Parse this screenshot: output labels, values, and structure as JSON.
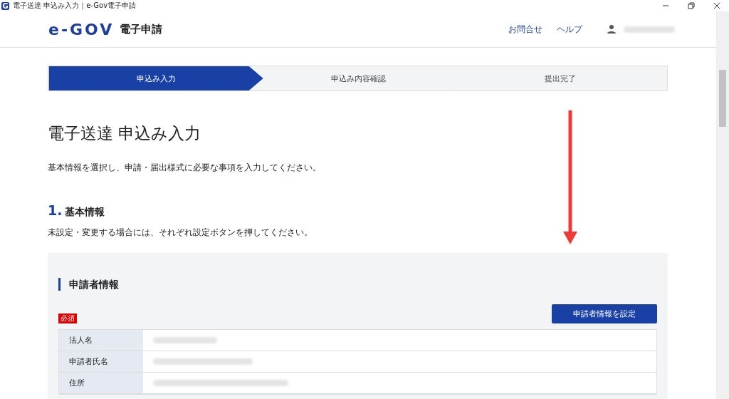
{
  "window": {
    "icon": "G",
    "title": "電子送達 申込み入力｜e-Gov電子申請"
  },
  "header": {
    "logo": "e-GOV",
    "service": "電子申請",
    "links": [
      "お問合せ",
      "ヘルプ"
    ]
  },
  "steps": [
    {
      "label": "申込み入力",
      "selected": true
    },
    {
      "label": "申込み内容確認",
      "selected": false
    },
    {
      "label": "提出完了",
      "selected": false
    }
  ],
  "page_title": "電子送達 申込み入力",
  "description": "基本情報を選択し、申請・届出様式に必要な事項を入力してください。",
  "section": {
    "number": "1.",
    "title": "基本情報",
    "note": "未設定・変更する場合には、それぞれ設定ボタンを押してください。"
  },
  "panel": {
    "title": "申請者情報",
    "required_badge": "必須",
    "set_button": "申請者情報を設定",
    "rows": [
      {
        "label": "法人名"
      },
      {
        "label": "申請者氏名"
      },
      {
        "label": "住所"
      }
    ]
  }
}
